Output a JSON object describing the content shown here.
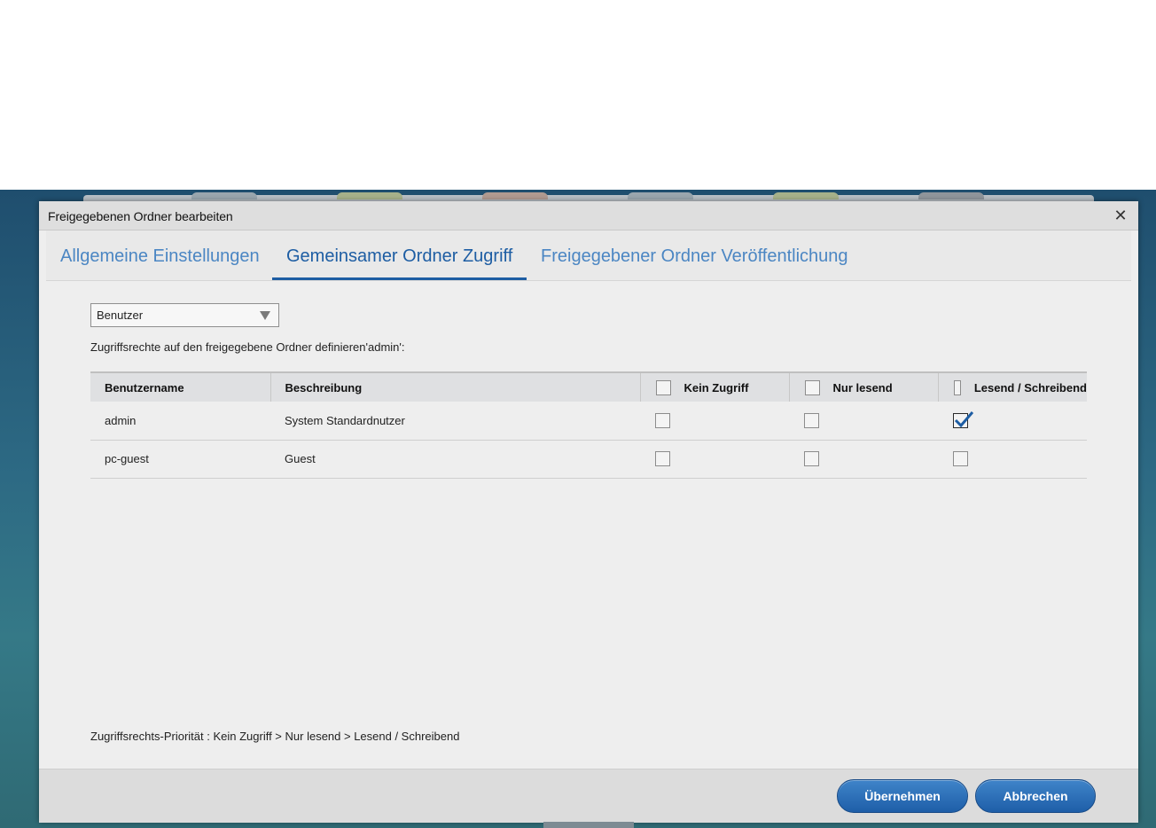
{
  "dialog": {
    "title": "Freigegebenen Ordner bearbeiten",
    "close_glyph": "✕"
  },
  "tabs": [
    {
      "label": "Allgemeine Einstellungen",
      "active": false
    },
    {
      "label": "Gemeinsamer Ordner Zugriff",
      "active": true
    },
    {
      "label": "Freigegebener Ordner Veröffentlichung",
      "active": false
    }
  ],
  "filter": {
    "selected": "Benutzer"
  },
  "description": "Zugriffsrechte auf den freigegebene Ordner definieren'admin':",
  "table": {
    "headers": {
      "username": "Benutzername",
      "description": "Beschreibung",
      "no_access": "Kein Zugriff",
      "read_only": "Nur lesend",
      "read_write": "Lesend / Schreibend"
    },
    "rows": [
      {
        "username": "admin",
        "description": "System Standardnutzer",
        "no_access": false,
        "read_only": false,
        "read_write": true
      },
      {
        "username": "pc-guest",
        "description": "Guest",
        "no_access": false,
        "read_only": false,
        "read_write": false
      }
    ]
  },
  "priority_note": "Zugriffsrechts-Priorität : Kein Zugriff > Nur lesend > Lesend / Schreibend",
  "buttons": {
    "apply": "Übernehmen",
    "cancel": "Abbrechen"
  },
  "colors": {
    "accent": "#1d5da3",
    "tab_inactive": "#4b86c3",
    "button": "#2a6bb5"
  }
}
